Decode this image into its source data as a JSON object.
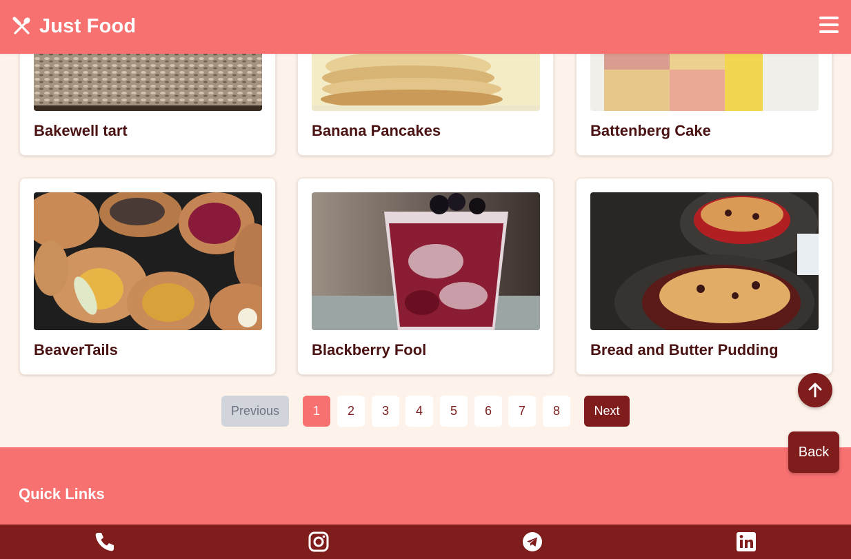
{
  "header": {
    "brand": "Just Food",
    "logo_icon": "utensils-icon",
    "menu_icon": "hamburger-menu-icon"
  },
  "recipes": [
    {
      "title": "Bakewell tart"
    },
    {
      "title": "Banana Pancakes"
    },
    {
      "title": "Battenberg Cake"
    },
    {
      "title": "BeaverTails"
    },
    {
      "title": "Blackberry Fool"
    },
    {
      "title": "Bread and Butter Pudding"
    }
  ],
  "pagination": {
    "previous": "Previous",
    "next": "Next",
    "pages": [
      "1",
      "2",
      "3",
      "4",
      "5",
      "6",
      "7",
      "8"
    ],
    "current": "1"
  },
  "floating": {
    "back": "Back",
    "scroll_top_icon": "arrow-up-icon"
  },
  "footer": {
    "quick_links": "Quick Links",
    "social_icons": [
      "phone-icon",
      "instagram-icon",
      "telegram-icon",
      "linkedin-icon"
    ]
  },
  "colors": {
    "primary": "#f87171",
    "dark": "#7f1d1d",
    "background": "#fdf3ea",
    "text": "#4a1212"
  }
}
